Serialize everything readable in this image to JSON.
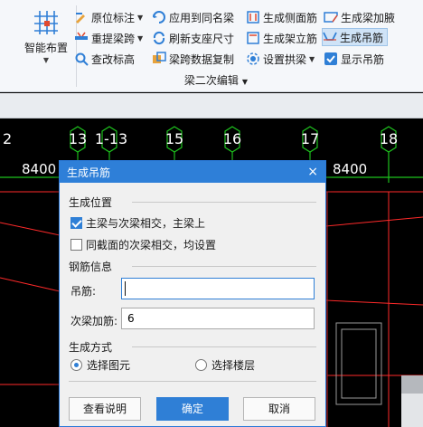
{
  "ribbon": {
    "big_button": {
      "label": "智能布置",
      "icon": "grid-beam-icon"
    },
    "items": [
      {
        "label": "原位标注",
        "icon": "annotate-icon",
        "dropdown": true
      },
      {
        "label": "重提梁跨",
        "icon": "beam-span-icon",
        "dropdown": true
      },
      {
        "label": "查改标高",
        "icon": "elevation-icon",
        "dropdown": false
      },
      {
        "label": "应用到同名梁",
        "icon": "apply-same-name-icon",
        "dropdown": false
      },
      {
        "label": "刷新支座尺寸",
        "icon": "refresh-support-icon",
        "dropdown": false
      },
      {
        "label": "梁跨数据复制",
        "icon": "copy-span-data-icon",
        "dropdown": false
      },
      {
        "label": "生成侧面筋",
        "icon": "side-rebar-icon",
        "dropdown": false
      },
      {
        "label": "生成架立筋",
        "icon": "erect-rebar-icon",
        "dropdown": false
      },
      {
        "label": "设置拱梁",
        "icon": "arch-beam-icon",
        "dropdown": true
      },
      {
        "label": "生成梁加腋",
        "icon": "haunch-icon",
        "dropdown": false
      },
      {
        "label": "生成吊筋",
        "icon": "hanger-rebar-icon",
        "dropdown": false,
        "selected": true
      },
      {
        "label": "显示吊筋",
        "icon": "show-hanger-checkbox-icon",
        "dropdown": false
      }
    ],
    "group_label": "梁二次编辑"
  },
  "cad": {
    "axis_labels": [
      "2",
      "13",
      "1-13",
      "15",
      "16",
      "17",
      "18"
    ],
    "dimensions": [
      "8400",
      "8400"
    ],
    "colors": {
      "axis_circle": "#1ec21e",
      "grid_line": "#ff2a2a",
      "text": "#ffffff"
    }
  },
  "dialog": {
    "title": "生成吊筋",
    "close": "×",
    "section_position": "生成位置",
    "check_main": {
      "label": "主梁与次梁相交，主梁上",
      "checked": true
    },
    "check_same": {
      "label": "同截面的次梁相交，均设置",
      "checked": false
    },
    "section_rebar": "钢筋信息",
    "hanger_label": "吊筋:",
    "hanger_value": "",
    "secondary_label": "次梁加筋:",
    "secondary_value": "6",
    "section_method": "生成方式",
    "radio_select_element": {
      "label": "选择图元",
      "checked": true
    },
    "radio_select_floor": {
      "label": "选择楼层",
      "checked": false
    },
    "btn_help": "查看说明",
    "btn_ok": "确定",
    "btn_cancel": "取消"
  }
}
